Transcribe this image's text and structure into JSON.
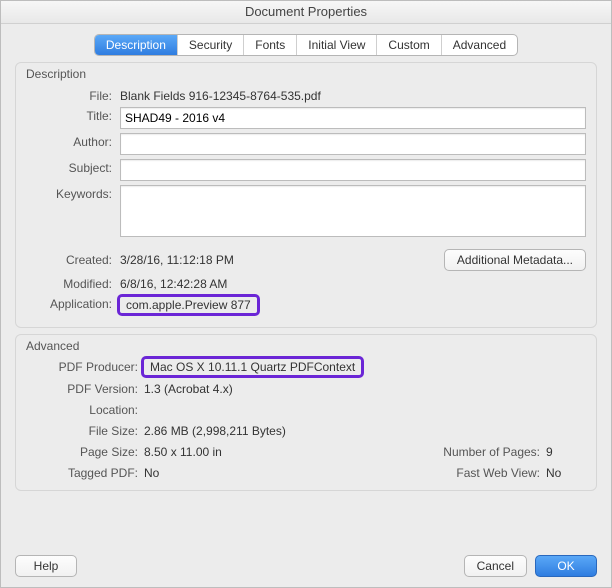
{
  "window": {
    "title": "Document Properties"
  },
  "tabs": [
    "Description",
    "Security",
    "Fonts",
    "Initial View",
    "Custom",
    "Advanced"
  ],
  "labels": {
    "description_group": "Description",
    "advanced_group": "Advanced",
    "file": "File:",
    "title": "Title:",
    "author": "Author:",
    "subject": "Subject:",
    "keywords": "Keywords:",
    "created": "Created:",
    "modified": "Modified:",
    "application": "Application:",
    "additional_metadata": "Additional Metadata...",
    "pdf_producer": "PDF Producer:",
    "pdf_version": "PDF Version:",
    "location": "Location:",
    "file_size": "File Size:",
    "page_size": "Page Size:",
    "num_pages": "Number of Pages:",
    "tagged_pdf": "Tagged PDF:",
    "fast_web": "Fast Web View:"
  },
  "desc": {
    "file": "Blank Fields 916-12345-8764-535.pdf",
    "title": "SHAD49 - 2016 v4",
    "author": "",
    "subject": "",
    "keywords": "",
    "created": "3/28/16, 11:12:18 PM",
    "modified": "6/8/16, 12:42:28 AM",
    "application": "com.apple.Preview 877"
  },
  "adv": {
    "producer": "Mac OS X 10.11.1 Quartz PDFContext",
    "version": "1.3 (Acrobat 4.x)",
    "location": "",
    "file_size": "2.86 MB (2,998,211 Bytes)",
    "page_size": "8.50 x 11.00 in",
    "num_pages": "9",
    "tagged": "No",
    "fast_web": "No"
  },
  "buttons": {
    "help": "Help",
    "cancel": "Cancel",
    "ok": "OK"
  }
}
